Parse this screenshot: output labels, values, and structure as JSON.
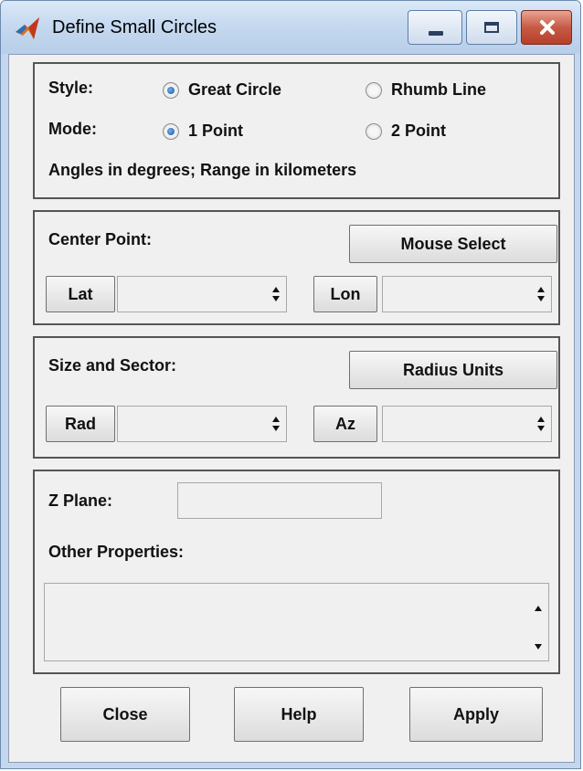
{
  "window": {
    "title": "Define Small Circles",
    "icons": {
      "app": "matlab-logo-icon",
      "minimize": "minimize-icon",
      "maximize": "maximize-icon",
      "close": "close-icon"
    },
    "close_button_color": "#c75a45"
  },
  "settings": {
    "style_label": "Style:",
    "style_options": [
      {
        "label": "Great Circle",
        "selected": true
      },
      {
        "label": "Rhumb Line",
        "selected": false
      }
    ],
    "mode_label": "Mode:",
    "mode_options": [
      {
        "label": "1 Point",
        "selected": true
      },
      {
        "label": "2 Point",
        "selected": false
      }
    ],
    "units_note": "Angles in degrees;  Range in kilometers"
  },
  "center_point": {
    "label": "Center Point:",
    "mouse_select_label": "Mouse Select",
    "lat_label": "Lat",
    "lat_value": "",
    "lon_label": "Lon",
    "lon_value": ""
  },
  "size_sector": {
    "label": "Size and Sector:",
    "radius_units_label": "Radius Units",
    "rad_label": "Rad",
    "rad_value": "",
    "az_label": "Az",
    "az_value": ""
  },
  "other": {
    "zplane_label": "Z Plane:",
    "zplane_value": "",
    "other_props_label": "Other Properties:",
    "other_props_value": ""
  },
  "footer": {
    "close_label": "Close",
    "help_label": "Help",
    "apply_label": "Apply"
  }
}
